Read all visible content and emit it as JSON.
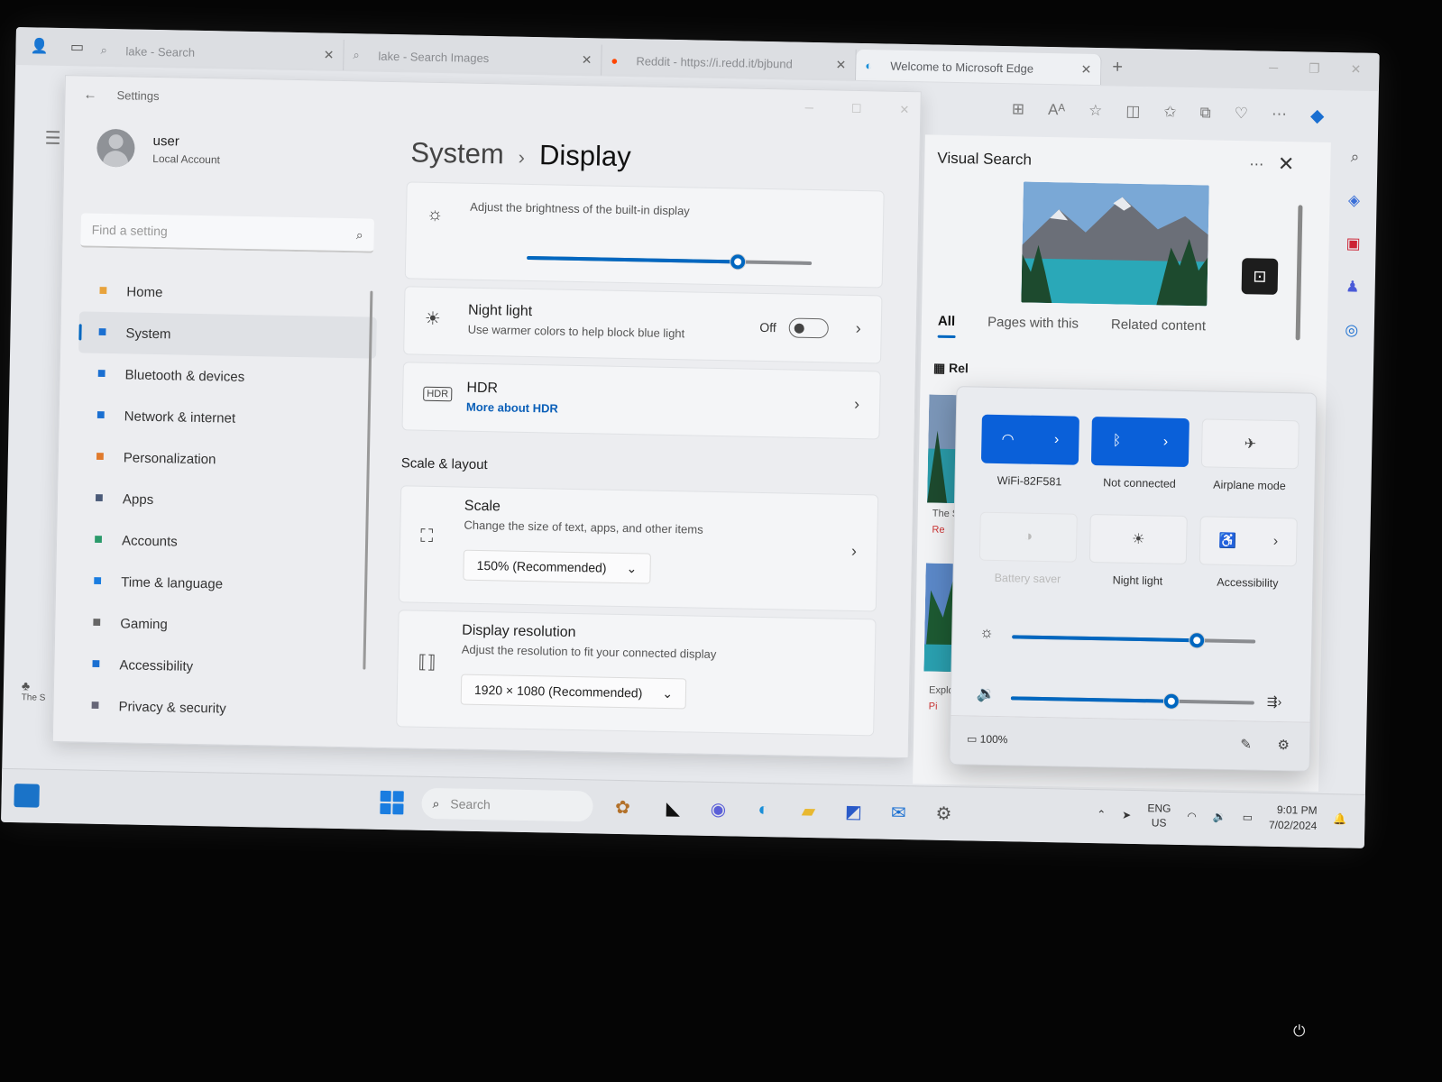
{
  "browser": {
    "tabs": [
      {
        "label": "lake - Search",
        "icon": "search-icon"
      },
      {
        "label": "lake - Search Images",
        "icon": "search-icon"
      },
      {
        "label": "Reddit - https://i.redd.it/bjbund",
        "icon": "reddit-icon"
      },
      {
        "label": "Welcome to Microsoft Edge",
        "icon": "edge-icon"
      }
    ],
    "new_tab": "+"
  },
  "settings": {
    "window_title": "Settings",
    "user_name": "user",
    "account_type": "Local Account",
    "search_placeholder": "Find a setting",
    "breadcrumb": {
      "parent": "System",
      "current": "Display"
    },
    "nav": [
      {
        "label": "Home",
        "icon": "home-icon",
        "color": "#e8a33c"
      },
      {
        "label": "System",
        "icon": "system-icon",
        "color": "#1a6fd1",
        "active": true
      },
      {
        "label": "Bluetooth & devices",
        "icon": "bluetooth-icon",
        "color": "#1a6fd1"
      },
      {
        "label": "Network & internet",
        "icon": "network-icon",
        "color": "#1a6fd1"
      },
      {
        "label": "Personalization",
        "icon": "brush-icon",
        "color": "#e07a2c"
      },
      {
        "label": "Apps",
        "icon": "apps-icon",
        "color": "#4a5a78"
      },
      {
        "label": "Accounts",
        "icon": "accounts-icon",
        "color": "#2a9a6a"
      },
      {
        "label": "Time & language",
        "icon": "globe-icon",
        "color": "#1a7de0"
      },
      {
        "label": "Gaming",
        "icon": "gaming-icon",
        "color": "#666"
      },
      {
        "label": "Accessibility",
        "icon": "accessibility-icon",
        "color": "#1a6fd1"
      },
      {
        "label": "Privacy & security",
        "icon": "shield-icon",
        "color": "#667"
      }
    ],
    "brightness": {
      "subtitle": "Adjust the brightness of the built-in display",
      "value": 0.74
    },
    "night_light": {
      "title": "Night light",
      "subtitle": "Use warmer colors to help block blue light",
      "state": "Off"
    },
    "hdr": {
      "title": "HDR",
      "link": "More about HDR"
    },
    "scale_layout": {
      "heading": "Scale & layout",
      "scale": {
        "title": "Scale",
        "subtitle": "Change the size of text, apps, and other items",
        "value": "150% (Recommended)"
      },
      "resolution": {
        "title": "Display resolution",
        "subtitle": "Adjust the resolution to fit your connected display",
        "value": "1920 × 1080 (Recommended)"
      }
    }
  },
  "visual_search": {
    "title": "Visual Search",
    "tabs": [
      "All",
      "Pages with this",
      "Related content"
    ],
    "related_label": "Rel",
    "captions": [
      "The S",
      "Re",
      "Explo",
      "Pi"
    ]
  },
  "quick_settings": {
    "wifi": "WiFi-82F581",
    "bluetooth": "Not connected",
    "airplane": "Airplane mode",
    "battery_saver": "Battery saver",
    "night_light": "Night light",
    "accessibility": "Accessibility",
    "brightness_level": 0.76,
    "volume_level": 0.66,
    "battery": "100%"
  },
  "taskbar": {
    "search_placeholder": "Search",
    "lang": "ENG",
    "region": "US",
    "time": "9:01 PM",
    "date": "7/02/2024"
  },
  "desktop": {
    "left_stub_text": "The S"
  }
}
